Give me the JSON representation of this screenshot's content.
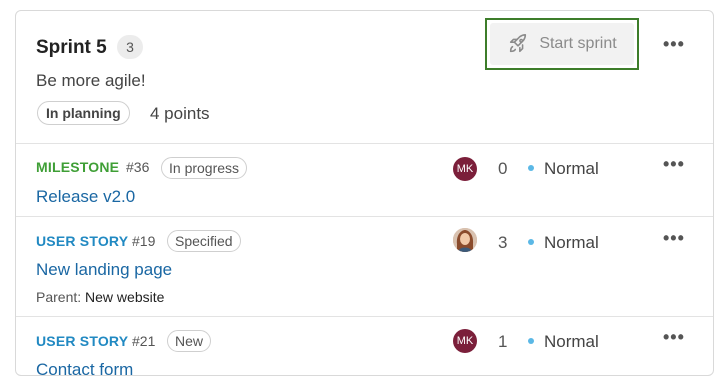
{
  "sprint": {
    "title": "Sprint 5",
    "count": "3",
    "description": "Be more agile!",
    "status": "In planning",
    "points": "4 points",
    "start_label": "Start sprint"
  },
  "colors": {
    "milestone": "#3f9f36",
    "user_story": "#2189c2",
    "link": "#1a67a3",
    "priority_dot": "#5bb8e6"
  },
  "items": [
    {
      "type": "MILESTONE",
      "number": "#36",
      "status": "In progress",
      "title": "Release v2.0",
      "assignee_initials": "MK",
      "story_points": "0",
      "priority": "Normal"
    },
    {
      "type": "USER STORY",
      "number": "#19",
      "status": "Specified",
      "title": "New landing page",
      "parent_label": "Parent:",
      "parent_value": "New website",
      "story_points": "3",
      "priority": "Normal"
    },
    {
      "type": "USER STORY",
      "number": "#21",
      "status": "New",
      "title": "Contact form",
      "assignee_initials": "MK",
      "story_points": "1",
      "priority": "Normal"
    }
  ],
  "menu_icon": "•••"
}
